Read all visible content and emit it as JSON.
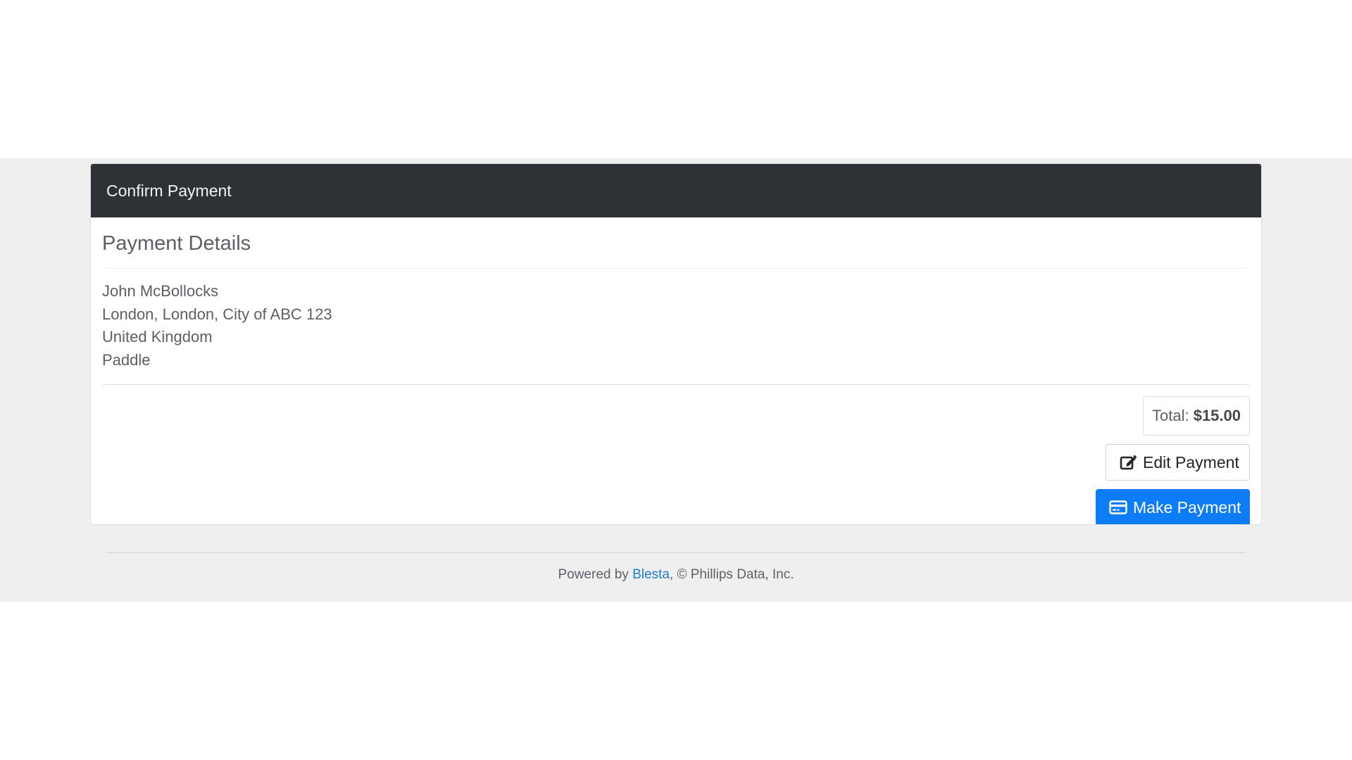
{
  "header": {
    "title": "Confirm Payment"
  },
  "details": {
    "title": "Payment Details",
    "name": "John McBollocks",
    "address_line": "London, London, City of ABC 123",
    "country": "United Kingdom",
    "method": "Paddle"
  },
  "summary": {
    "total_label": "Total:",
    "total_amount": "$15.00"
  },
  "buttons": {
    "edit_label": "Edit Payment",
    "edit_icon": "edit-icon",
    "pay_label": "Make Payment",
    "pay_icon": "credit-card-icon"
  },
  "footer": {
    "powered_by": "Powered by",
    "link_text": "Blesta",
    "copyright": ", © Phillips Data, Inc."
  },
  "colors": {
    "header_bg": "#2e3236",
    "primary": "#0d7cf7",
    "link": "#1f7fc9",
    "page_band": "#efefef"
  }
}
